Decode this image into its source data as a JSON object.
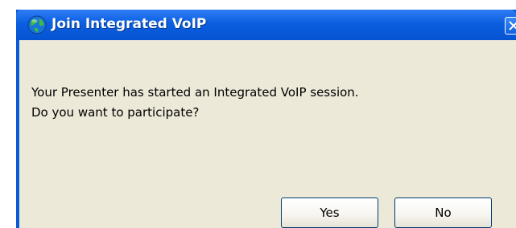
{
  "window": {
    "title": "Join Integrated VoIP",
    "icon": "globe-icon",
    "close_icon": "close-icon"
  },
  "message": {
    "line1": "Your Presenter has started an Integrated VoIP session.",
    "line2": "Do you want to participate?"
  },
  "buttons": {
    "yes_label": "Yes",
    "no_label": "No"
  },
  "colors": {
    "titlebar": "#0553d2",
    "client_bg": "#ece9d8",
    "button_border": "#003c74"
  }
}
